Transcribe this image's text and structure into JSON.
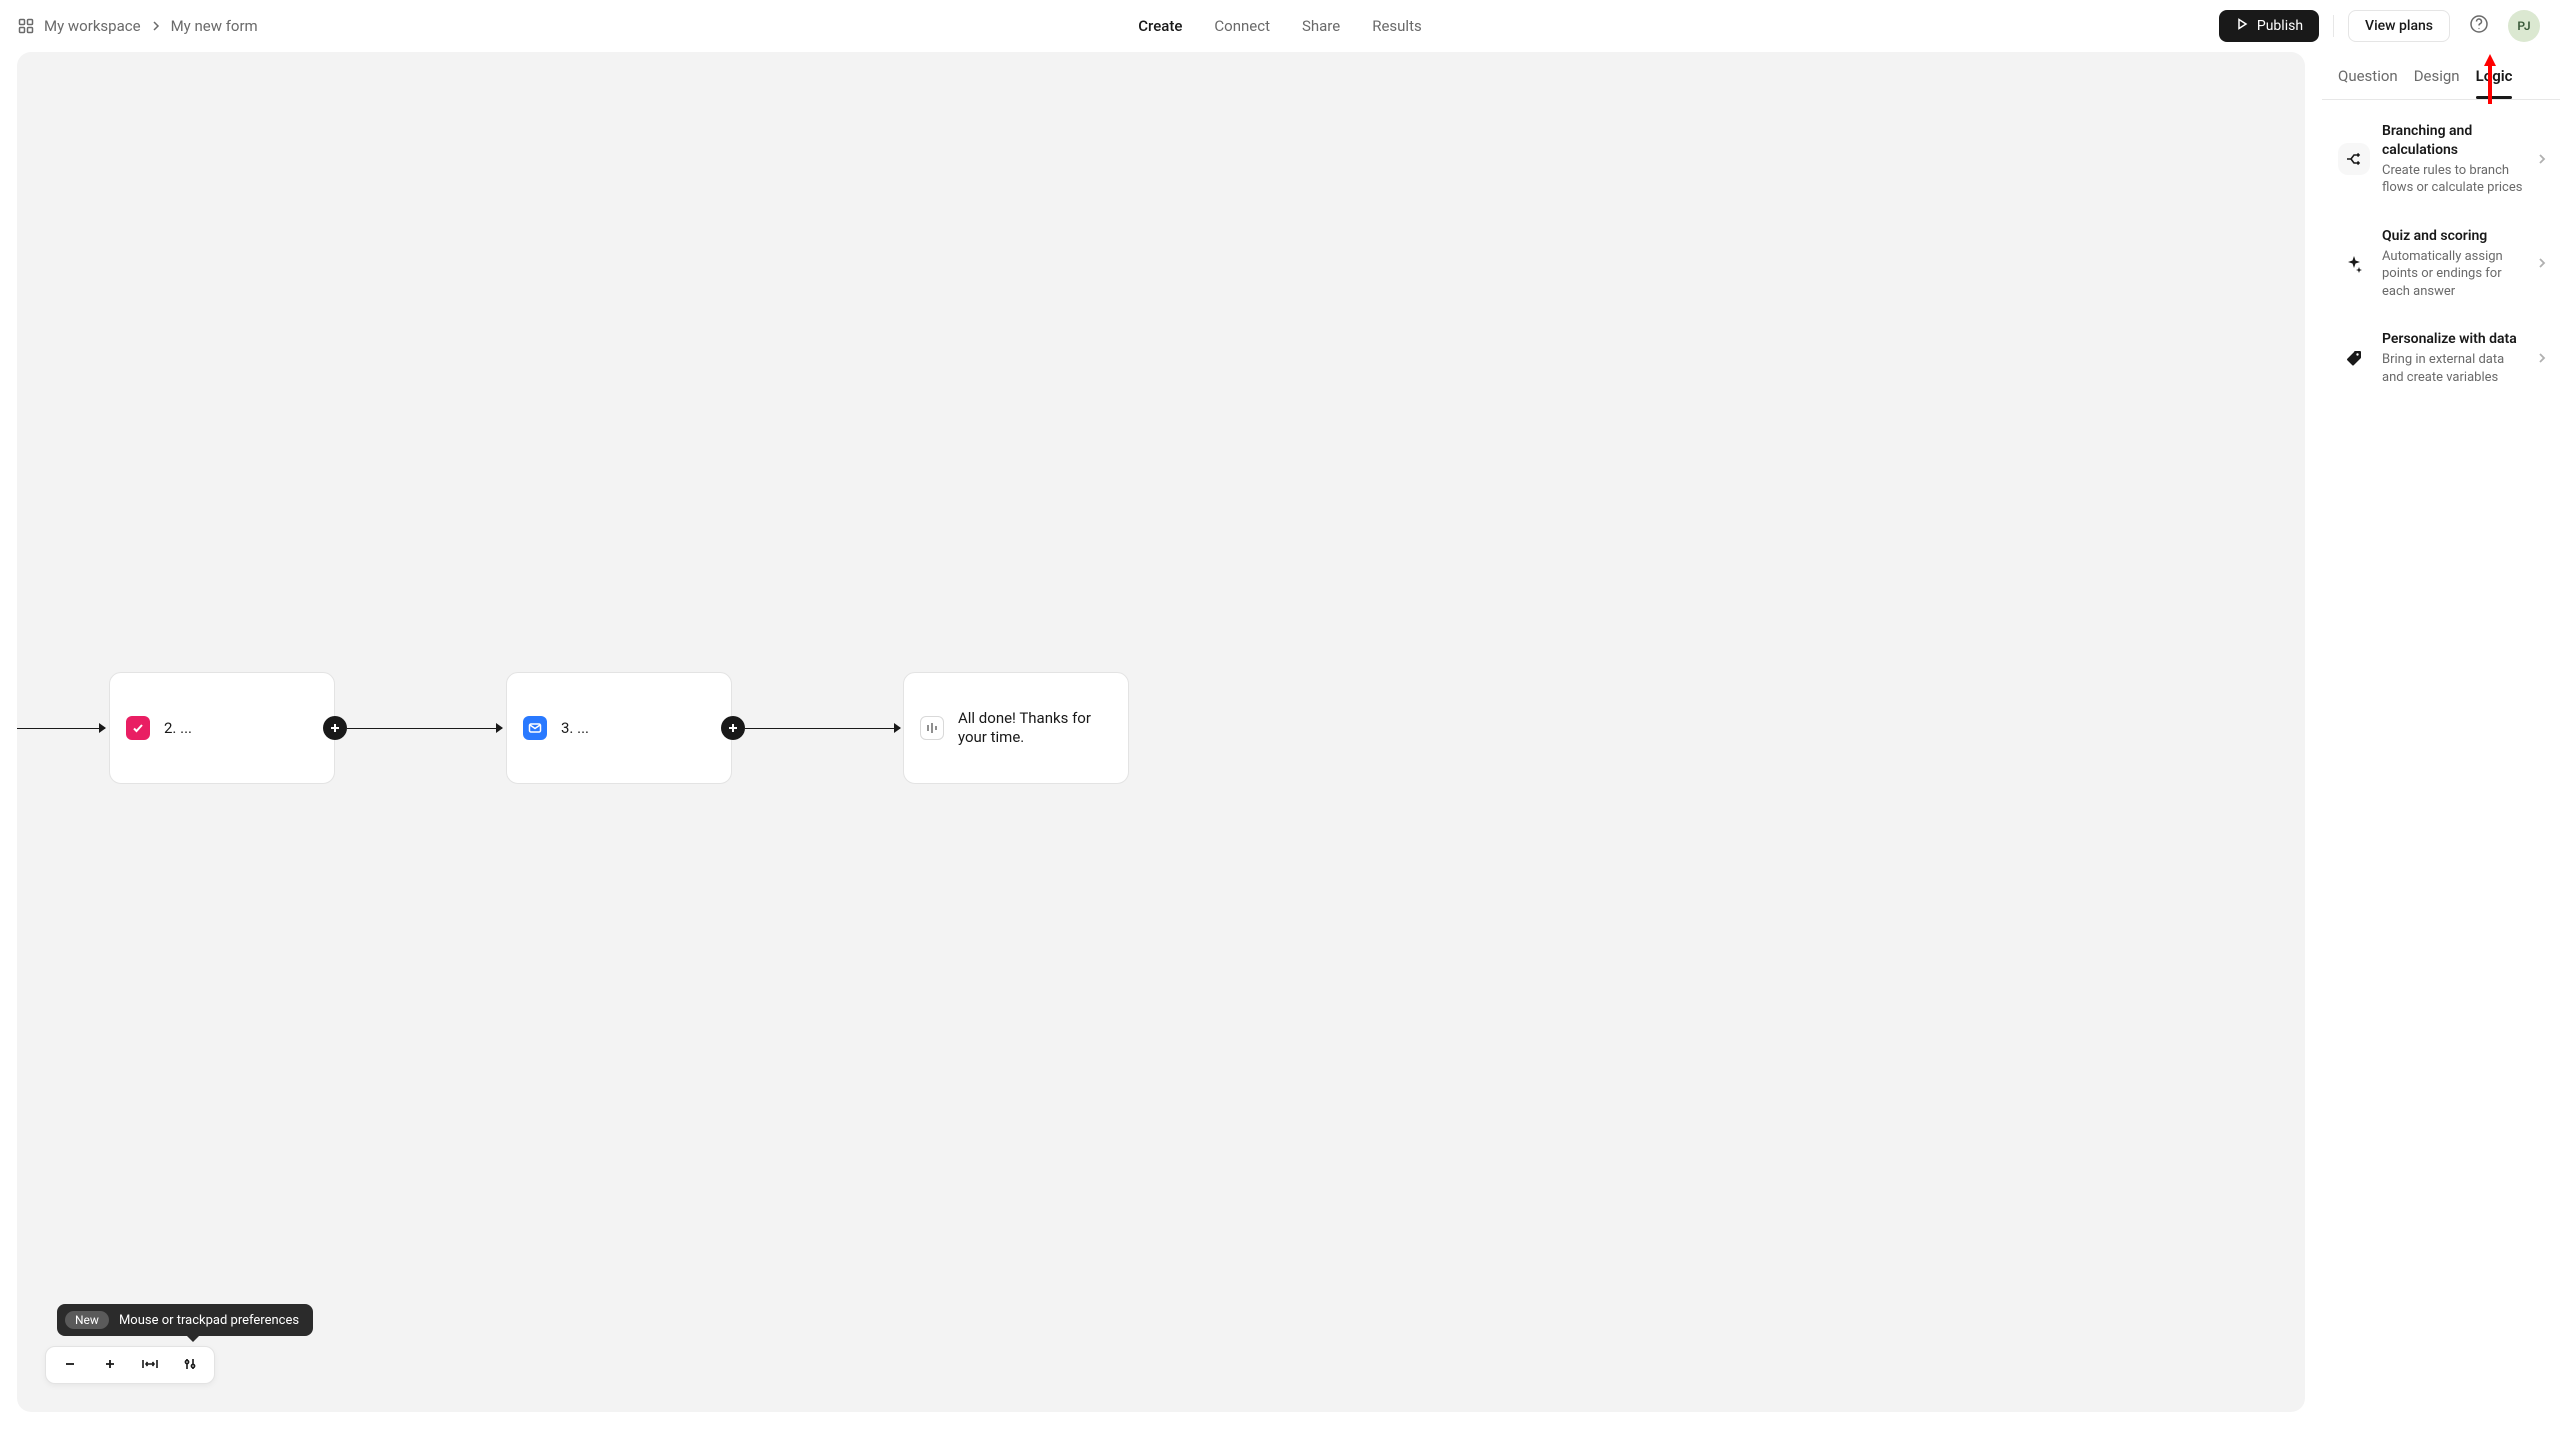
{
  "breadcrumb": {
    "workspace": "My workspace",
    "current": "My new form"
  },
  "top_tabs": {
    "create": "Create",
    "connect": "Connect",
    "share": "Share",
    "results": "Results"
  },
  "top_actions": {
    "publish": "Publish",
    "view_plans": "View plans",
    "avatar_initials": "PJ"
  },
  "panel_tabs": {
    "question": "Question",
    "design": "Design",
    "logic": "Logic"
  },
  "logic_items": [
    {
      "title": "Branching and calculations",
      "desc": "Create rules to branch flows or calculate prices"
    },
    {
      "title": "Quiz and scoring",
      "desc": "Automatically assign points or endings for each answer"
    },
    {
      "title": "Personalize with data",
      "desc": "Bring in external data and create variables"
    }
  ],
  "nodes": {
    "n2_prefix": "2.",
    "n2_trunc": "...",
    "n3_prefix": "3.",
    "n3_trunc": "...",
    "end_text": "All done! Thanks for your time."
  },
  "tooltip": {
    "pill": "New",
    "text": "Mouse or trackpad preferences"
  }
}
